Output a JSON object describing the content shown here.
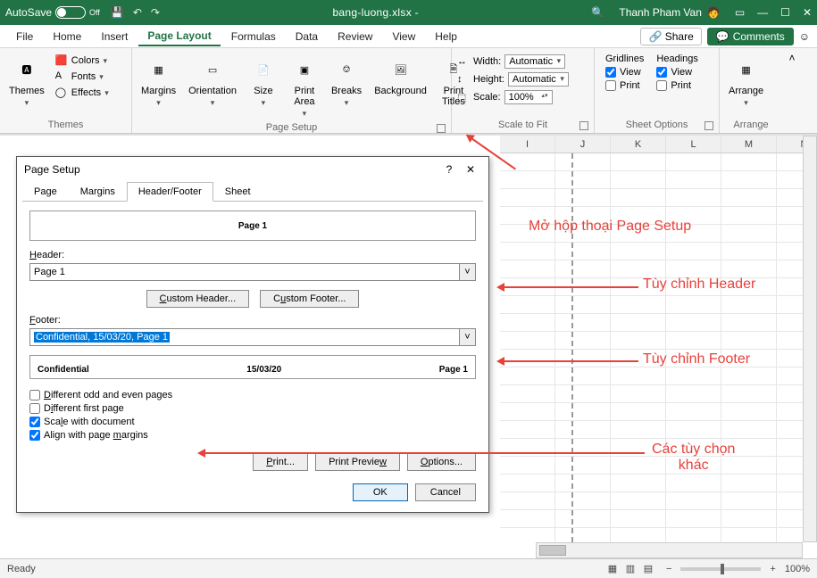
{
  "titlebar": {
    "autosave_label": "AutoSave",
    "autosave_state": "Off",
    "filename": "bang-luong.xlsx  -",
    "username": "Thanh Pham Van"
  },
  "menu": {
    "tabs": [
      "File",
      "Home",
      "Insert",
      "Page Layout",
      "Formulas",
      "Data",
      "Review",
      "View",
      "Help"
    ],
    "active": "Page Layout",
    "share": "Share",
    "comments": "Comments"
  },
  "ribbon": {
    "themes": {
      "label": "Themes",
      "colors": "Colors",
      "fonts": "Fonts",
      "effects": "Effects",
      "btn": "Themes"
    },
    "pagesetup": {
      "label": "Page Setup",
      "margins": "Margins",
      "orientation": "Orientation",
      "size": "Size",
      "printarea": "Print\nArea",
      "breaks": "Breaks",
      "background": "Background",
      "printtitles": "Print\nTitles"
    },
    "scale": {
      "label": "Scale to Fit",
      "width": "Width:",
      "height": "Height:",
      "scale": "Scale:",
      "auto": "Automatic",
      "pct": "100%"
    },
    "sheetopts": {
      "label": "Sheet Options",
      "gridlines": "Gridlines",
      "headings": "Headings",
      "view": "View",
      "print": "Print"
    },
    "arrange": {
      "label": "Arrange",
      "btn": "Arrange"
    }
  },
  "columns": [
    "I",
    "J",
    "K",
    "L",
    "M",
    "N"
  ],
  "dialog": {
    "title": "Page Setup",
    "tabs": [
      "Page",
      "Margins",
      "Header/Footer",
      "Sheet"
    ],
    "active": "Header/Footer",
    "header_preview": "Page 1",
    "header_label": "Header:",
    "header_value": "Page 1",
    "custom_header": "Custom Header...",
    "custom_footer": "Custom Footer...",
    "footer_label": "Footer:",
    "footer_value": "Confidential, 15/03/20, Page 1",
    "footer_left": "Confidential",
    "footer_center": "15/03/20",
    "footer_right": "Page 1",
    "opt_oddeven": "Different odd and even pages",
    "opt_firstpage": "Different first page",
    "opt_scale": "Scale with document",
    "opt_align": "Align with page margins",
    "print": "Print...",
    "preview": "Print Preview",
    "options": "Options...",
    "ok": "OK",
    "cancel": "Cancel"
  },
  "annotations": {
    "a1": "Mở hộp thoại Page Setup",
    "a2": "Tùy chỉnh Header",
    "a3": "Tùy chỉnh Footer",
    "a4": "Các tùy chọn\nkhác"
  },
  "status": {
    "ready": "Ready",
    "zoom": "100%"
  }
}
